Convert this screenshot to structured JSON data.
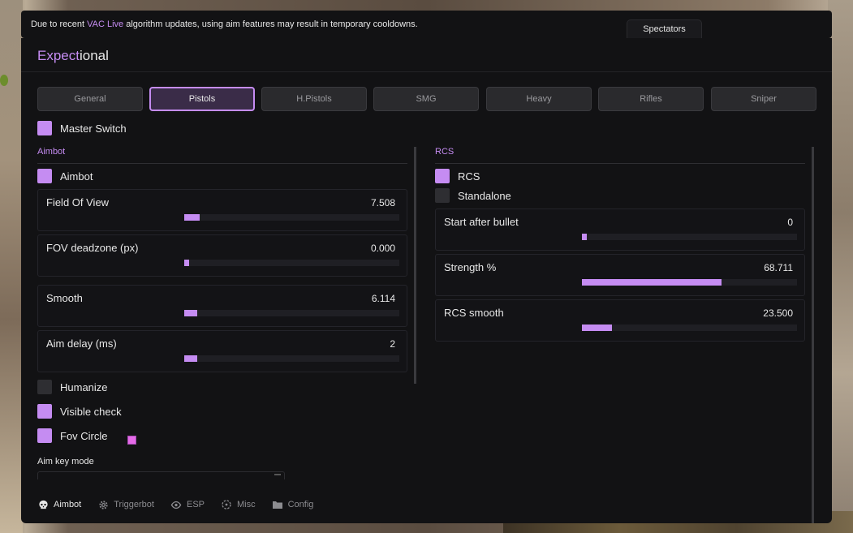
{
  "notice": {
    "prefix": "Due to recent ",
    "highlight": "VAC Live",
    "suffix": " algorithm updates, using aim features may result in temporary cooldowns."
  },
  "spectators_label": "Spectators",
  "logo": {
    "accent": "Expect",
    "rest": "ional"
  },
  "tabs": [
    "General",
    "Pistols",
    "H.Pistols",
    "SMG",
    "Heavy",
    "Rifles",
    "Sniper"
  ],
  "active_tab": "Pistols",
  "master_switch": {
    "label": "Master Switch",
    "checked": true
  },
  "aimbot_section": {
    "title": "Aimbot",
    "aimbot_toggle": {
      "label": "Aimbot",
      "checked": true
    },
    "sliders": [
      {
        "label": "Field Of View",
        "value": "7.508",
        "fraction": 0.07
      },
      {
        "label": "FOV deadzone (px)",
        "value": "0.000",
        "fraction": 0.0
      },
      {
        "label": "Smooth",
        "value": "6.114",
        "fraction": 0.06
      },
      {
        "label": "Aim delay (ms)",
        "value": "2",
        "fraction": 0.06
      }
    ],
    "humanize": {
      "label": "Humanize",
      "checked": false
    },
    "visible_check": {
      "label": "Visible check",
      "checked": true
    },
    "fov_circle": {
      "label": "Fov Circle",
      "checked": true,
      "color": "#e56ae8"
    },
    "aim_key_mode_label": "Aim key mode"
  },
  "rcs_section": {
    "title": "RCS",
    "rcs_toggle": {
      "label": "RCS",
      "checked": true
    },
    "standalone": {
      "label": "Standalone",
      "checked": false
    },
    "sliders": [
      {
        "label": "Start after bullet",
        "value": "0",
        "fraction": 0.0
      },
      {
        "label": "Strength %",
        "value": "68.711",
        "fraction": 0.65
      },
      {
        "label": "RCS smooth",
        "value": "23.500",
        "fraction": 0.14
      }
    ]
  },
  "bottom_nav": [
    {
      "label": "Aimbot",
      "icon": "skull-icon",
      "active": true
    },
    {
      "label": "Triggerbot",
      "icon": "gear-icon",
      "active": false
    },
    {
      "label": "ESP",
      "icon": "eye-icon",
      "active": false
    },
    {
      "label": "Misc",
      "icon": "crosshair-icon",
      "active": false
    },
    {
      "label": "Config",
      "icon": "folder-icon",
      "active": false
    }
  ],
  "colors": {
    "accent": "#c58cf2",
    "panel": "#121214",
    "track": "#1f1f24"
  }
}
